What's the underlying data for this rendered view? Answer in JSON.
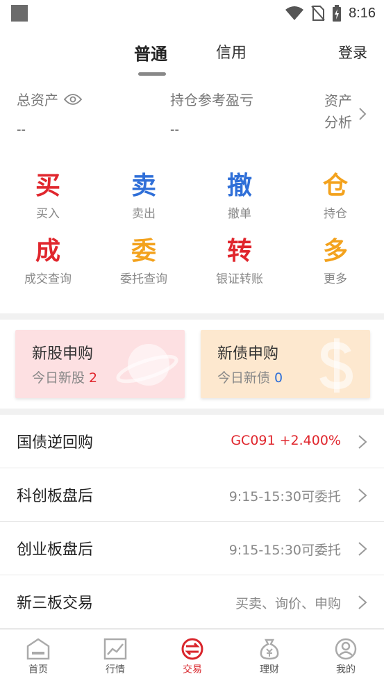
{
  "status_bar": {
    "time": "8:16"
  },
  "tabs": {
    "normal": "普通",
    "credit": "信用"
  },
  "header": {
    "login": "登录"
  },
  "assets": {
    "total_label": "总资产",
    "total_value": "--",
    "pnl_label": "持仓参考盈亏",
    "pnl_value": "--",
    "analysis_line1": "资产",
    "analysis_line2": "分析"
  },
  "actions": [
    {
      "glyph": "买",
      "label": "买入",
      "color": "#e0262d"
    },
    {
      "glyph": "卖",
      "label": "卖出",
      "color": "#2f6fd8"
    },
    {
      "glyph": "撤",
      "label": "撤单",
      "color": "#2f6fd8"
    },
    {
      "glyph": "仓",
      "label": "持仓",
      "color": "#f3a21d"
    },
    {
      "glyph": "成",
      "label": "成交查询",
      "color": "#e0262d"
    },
    {
      "glyph": "委",
      "label": "委托查询",
      "color": "#f3a21d"
    },
    {
      "glyph": "转",
      "label": "银证转账",
      "color": "#e0262d"
    },
    {
      "glyph": "多",
      "label": "更多",
      "color": "#f3a21d"
    }
  ],
  "cards": {
    "ipo": {
      "title": "新股申购",
      "sub": "今日新股",
      "count": "2",
      "count_color": "#e0262d"
    },
    "bond": {
      "title": "新债申购",
      "sub": "今日新债",
      "count": "0",
      "count_color": "#2f6fd8"
    }
  },
  "list": [
    {
      "title": "国债逆回购",
      "detail": "GC091 +2.400%",
      "detail_color": "#e0262d"
    },
    {
      "title": "科创板盘后",
      "detail": "9:15-15:30可委托",
      "detail_color": "#888888"
    },
    {
      "title": "创业板盘后",
      "detail": "9:15-15:30可委托",
      "detail_color": "#888888"
    },
    {
      "title": "新三板交易",
      "detail": "买卖、询价、申购",
      "detail_color": "#888888"
    }
  ],
  "bottom_nav": [
    {
      "label": "首页",
      "icon": "home-icon"
    },
    {
      "label": "行情",
      "icon": "market-chart-icon"
    },
    {
      "label": "交易",
      "icon": "trade-icon",
      "active": true
    },
    {
      "label": "理财",
      "icon": "money-bag-icon"
    },
    {
      "label": "我的",
      "icon": "profile-icon"
    }
  ]
}
